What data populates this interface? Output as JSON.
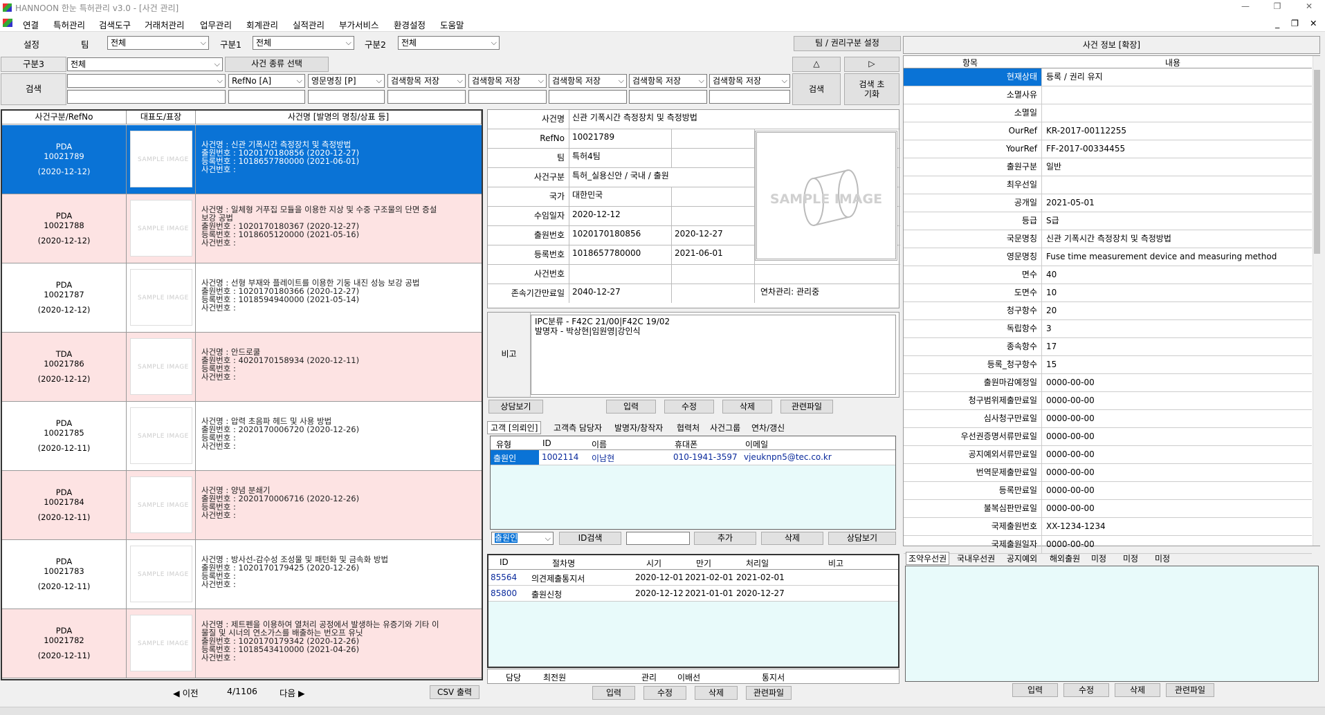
{
  "window": {
    "title": "HANNOON 한눈 특허관리 v3.0 - [사건 관리]",
    "min": "—",
    "max": "❐",
    "close": "✕"
  },
  "menu": [
    "연결",
    "특허관리",
    "검색도구",
    "거래처관리",
    "업무관리",
    "회계관리",
    "실적관리",
    "부가서비스",
    "환경설정",
    "도움말"
  ],
  "mdi": {
    "min": "_",
    "restore": "❐",
    "close": "✕"
  },
  "filter": {
    "setting_label": "설정",
    "team_label": "팀",
    "team_value": "전체",
    "cat1_label": "구분1",
    "cat1_value": "전체",
    "cat2_label": "구분2",
    "cat2_value": "전체",
    "team_rights_button": "팀 / 권리구분 설정",
    "cat3_label": "구분3",
    "cat3_value": "전체",
    "case_type_button": "사건 종류 선택",
    "up_button": "△",
    "next_button": "▷",
    "search_label": "검색",
    "search_combos": [
      "",
      "RefNo [A]",
      "영문명칭 [P]",
      "검색항목 저장",
      "검색항목 저장",
      "검색항목 저장",
      "검색항목 저장",
      "검색항목 저장"
    ],
    "search_button": "검색",
    "reset_button": "검색 초기화"
  },
  "list": {
    "headers": [
      "사건구분/RefNo",
      "대표도/표장",
      "사건명 [발명의 명칭/상표 등]"
    ],
    "thumb_text": "SAMPLE IMAGE",
    "rows": [
      {
        "type": "PDA",
        "ref": "10021789",
        "date": "(2020-12-12)",
        "lines": [
          "사건명 : 신관 기폭시간 측정장치 및 측정방법",
          "출원번호 : 1020170180856 (2020-12-27)",
          "등록번호 : 1018657780000 (2021-06-01)",
          "사건번호 :"
        ]
      },
      {
        "type": "PDA",
        "ref": "10021788",
        "date": "(2020-12-12)",
        "lines": [
          "사건명 : 일체형 거푸집 모듈을 이용한 지상 및 수중 구조물의 단면 증설",
          "보강 공법",
          "출원번호 : 1020170180367 (2020-12-27)",
          "등록번호 : 1018605120000 (2021-05-16)",
          "사건번호 :"
        ]
      },
      {
        "type": "PDA",
        "ref": "10021787",
        "date": "(2020-12-12)",
        "lines": [
          "사건명 : 선형 부재와 플레이트를 이용한 기둥 내진 성능 보강 공법",
          "출원번호 : 1020170180366 (2020-12-27)",
          "등록번호 : 1018594940000 (2021-05-14)",
          "사건번호 :"
        ]
      },
      {
        "type": "TDA",
        "ref": "10021786",
        "date": "(2020-12-12)",
        "lines": [
          "사건명 : 안드로쿨",
          "출원번호 : 4020170158934 (2020-12-11)",
          "등록번호 :",
          "사건번호 :"
        ]
      },
      {
        "type": "PDA",
        "ref": "10021785",
        "date": "(2020-12-11)",
        "lines": [
          "사건명 : 압력 초음파 헤드 및 사용 방법",
          "출원번호 : 2020170006720 (2020-12-26)",
          "등록번호 :",
          "사건번호 :"
        ]
      },
      {
        "type": "PDA",
        "ref": "10021784",
        "date": "(2020-12-11)",
        "lines": [
          "사건명 : 양념 분쇄기",
          "출원번호 : 2020170006716 (2020-12-26)",
          "등록번호 :",
          "사건번호 :"
        ]
      },
      {
        "type": "PDA",
        "ref": "10021783",
        "date": "(2020-12-11)",
        "lines": [
          "사건명 : 방사선-감수성 조성물 및 패턴화 및 금속화 방법",
          "출원번호 : 1020170179425 (2020-12-26)",
          "등록번호 :",
          "사건번호 :"
        ]
      },
      {
        "type": "PDA",
        "ref": "10021782",
        "date": "(2020-12-11)",
        "lines": [
          "사건명 : 제트펜을 이용하여 열처리 공정에서 발생하는 유증기와 기타 이",
          "물질 및 시너의 연소가스를 배출하는 번오프 유닛",
          "출원번호 : 1020170179342 (2020-12-26)",
          "등록번호 : 1018543410000 (2021-04-26)",
          "사건번호 :"
        ]
      }
    ],
    "prev": "◀ 이전",
    "page": "4/1106",
    "next": "다음 ▶",
    "csv": "CSV 출력"
  },
  "detail": {
    "rows": [
      {
        "k": "사건명",
        "v": [
          "신관 기폭시간 측정장치 및 측정방법"
        ]
      },
      {
        "k": "RefNo",
        "v": [
          "10021789",
          ""
        ]
      },
      {
        "k": "팀",
        "v": [
          "특허4팀",
          ""
        ]
      },
      {
        "k": "사건구분",
        "v": [
          "특허_실용신안 / 국내 / 출원"
        ]
      },
      {
        "k": "국가",
        "v": [
          "대한민국",
          ""
        ]
      },
      {
        "k": "수임일자",
        "v": [
          "2020-12-12",
          ""
        ]
      },
      {
        "k": "출원번호",
        "v": [
          "1020170180856",
          "2020-12-27"
        ]
      },
      {
        "k": "등록번호",
        "v": [
          "1018657780000",
          "2021-06-01"
        ]
      },
      {
        "k": "사건번호",
        "v": [
          "",
          ""
        ]
      },
      {
        "k": "존속기간만료일",
        "v": [
          "2040-12-27",
          ""
        ]
      }
    ],
    "annuity": "연차관리: 관리중",
    "image_text": "SAMPLE IMAGE",
    "note_label": "비고",
    "note_lines": [
      "IPC분류 - F42C 21/00|F42C 19/02",
      "발명자 - 박상현|임원영|강인식"
    ],
    "buttons": [
      "상담보기",
      "입력",
      "수정",
      "삭제",
      "관련파일"
    ]
  },
  "client": {
    "tabs": [
      "고객 [의뢰인]",
      "고객측 담당자",
      "발명자/창작자",
      "협력처",
      "사건그룹",
      "연차/갱신"
    ],
    "headers": [
      "유형",
      "ID",
      "이름",
      "휴대폰",
      "이메일"
    ],
    "rows": [
      [
        "출원인",
        "1002114",
        "이남현",
        "010-1941-3597",
        "vjeuknpn5@tec.co.kr"
      ]
    ],
    "combo": "출원인",
    "buttons": [
      "ID검색",
      "추가",
      "삭제",
      "상담보기"
    ]
  },
  "procedure": {
    "headers": [
      "ID",
      "절차명",
      "시기",
      "만기",
      "처리일",
      "비고"
    ],
    "rows": [
      [
        "85564",
        "의견제출통지서",
        "2020-12-01",
        "2021-02-01",
        "2021-02-01",
        ""
      ],
      [
        "85800",
        "출원신청",
        "2020-12-12",
        "2021-01-01",
        "2020-12-27",
        ""
      ]
    ],
    "footer": {
      "k1": "담당",
      "v1": "최전원",
      "k2": "관리",
      "v2": "이배선",
      "k3": "통지서",
      "v3": ""
    },
    "buttons": [
      "입력",
      "수정",
      "삭제",
      "관련파일"
    ]
  },
  "info": {
    "title": "사건 정보 [확장]",
    "headers": [
      "항목",
      "내용"
    ],
    "rows": [
      [
        "현재상태",
        "등록 / 권리 유지"
      ],
      [
        "소멸사유",
        ""
      ],
      [
        "소멸일",
        ""
      ],
      [
        "OurRef",
        "KR-2017-00112255"
      ],
      [
        "YourRef",
        "FF-2017-00334455"
      ],
      [
        "출원구분",
        "일반"
      ],
      [
        "최우선일",
        ""
      ],
      [
        "공개일",
        "2021-05-01"
      ],
      [
        "등급",
        "S급"
      ],
      [
        "국문명칭",
        "신관 기폭시간 측정장치 및 측정방법"
      ],
      [
        "영문명칭",
        "Fuse time measurement device and measuring method"
      ],
      [
        "면수",
        "40"
      ],
      [
        "도면수",
        "10"
      ],
      [
        "청구항수",
        "20"
      ],
      [
        "독립항수",
        "3"
      ],
      [
        "종속항수",
        "17"
      ],
      [
        "등록_청구항수",
        "15"
      ],
      [
        "출원마감예정일",
        "0000-00-00"
      ],
      [
        "청구범위제출만료일",
        "0000-00-00"
      ],
      [
        "심사청구만료일",
        "0000-00-00"
      ],
      [
        "우선권증명서류만료일",
        "0000-00-00"
      ],
      [
        "공지예외서류만료일",
        "0000-00-00"
      ],
      [
        "번역문제출만료일",
        "0000-00-00"
      ],
      [
        "등록만료일",
        "0000-00-00"
      ],
      [
        "불복심판만료일",
        "0000-00-00"
      ],
      [
        "국제출원번호",
        "XX-1234-1234"
      ],
      [
        "국제출원일자",
        "0000-00-00"
      ]
    ],
    "tabs": [
      "조약우선권",
      "국내우선권",
      "공지예외",
      "해외출원",
      "미정",
      "미정",
      "미정"
    ],
    "buttons": [
      "입력",
      "수정",
      "삭제",
      "관련파일"
    ]
  }
}
